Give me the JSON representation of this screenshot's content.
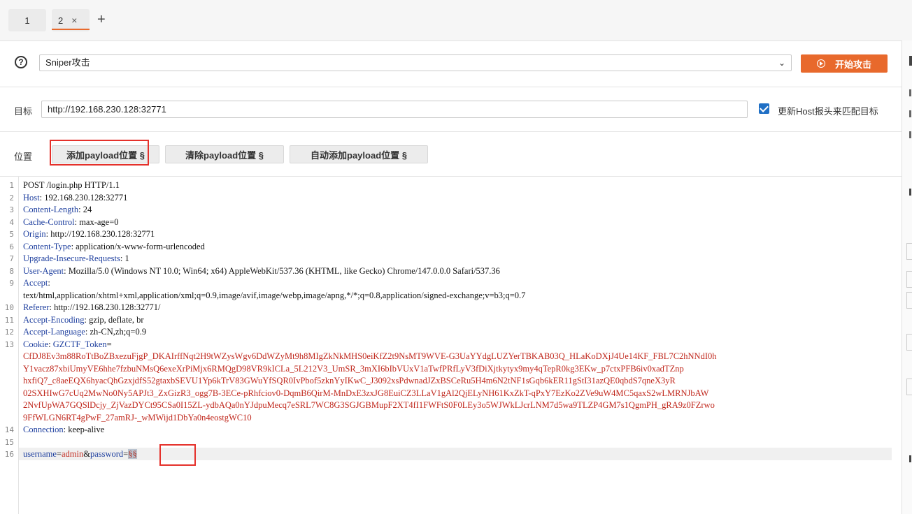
{
  "tabs": [
    {
      "label": "1"
    },
    {
      "label": "2",
      "close": "×"
    }
  ],
  "tab_add": "+",
  "attack": {
    "help": "?",
    "type_selected": "Sniper攻击",
    "start_button": "开始攻击"
  },
  "target": {
    "label": "目标",
    "url": "http://192.168.230.128:32771",
    "update_host_label": "更新Host报头来匹配目标",
    "update_host_checked": true
  },
  "positions": {
    "label": "位置",
    "add_button": "添加payload位置 §",
    "clear_button": "清除payload位置 §",
    "auto_button": "自动添加payload位置 §"
  },
  "request": {
    "line1": "POST /login.php HTTP/1.1",
    "headers": [
      {
        "name": "Host",
        "value": " 192.168.230.128:32771"
      },
      {
        "name": "Content-Length",
        "value": " 24"
      },
      {
        "name": "Cache-Control",
        "value": " max-age=0"
      },
      {
        "name": "Origin",
        "value": " http://192.168.230.128:32771"
      },
      {
        "name": "Content-Type",
        "value": " application/x-www-form-urlencoded"
      },
      {
        "name": "Upgrade-Insecure-Requests",
        "value": " 1"
      },
      {
        "name": "User-Agent",
        "value": " Mozilla/5.0 (Windows NT 10.0; Win64; x64) AppleWebKit/537.36 (KHTML, like Gecko) Chrome/147.0.0.0 Safari/537.36"
      },
      {
        "name": "Accept",
        "value": ""
      },
      {
        "name": "Referer",
        "value": " http://192.168.230.128:32771/"
      },
      {
        "name": "Accept-Encoding",
        "value": " gzip, deflate, br"
      },
      {
        "name": "Accept-Language",
        "value": " zh-CN,zh;q=0.9"
      }
    ],
    "accept_value": "text/html,application/xhtml+xml,application/xml;q=0.9,image/avif,image/webp,image/apng,*/*;q=0.8,application/signed-exchange;v=b3;q=0.7",
    "cookie_name": "Cookie",
    "cookie_key": "GZCTF_Token",
    "cookie_value_lines": [
      "CfDJ8Ev3m88RoTtBoZBxezuFjgP_DKAIrffNqt2H9tWZysWgv6DdWZyMt9h8MIgZkNkMHS0eiKfZ2t9NsMT9WVE-G3UaYYdgLUZYerTBKAB03Q_HLaKoDXjJ4Ue14KF_FBL7C2hNNdI0h",
      "Y1vacz87xbiUmyVE6hhe7fzbuNMsQ6exeXrPiMjx6RMQgD98VR9kICLa_5L212V3_UmSR_3mXI6bIbVUxV1aTwfPRfLyV3fDiXjtkytyx9my4qTepR0kg3EKw_p7ctxPFB6iv0xadTZnp",
      "hxfiQ7_c8aeEQX6hyacQhGzxjdfS52gtaxbSEVU1Yp6kTrV83GWuYfSQR0IvPbof5zknYyIKwC_J3092xsPdwnadJZxBSCeRu5H4m6N2tNF1sGqb6kER11gStI31azQE0qbdS7qneX3yR",
      "02SXHIwG7cUq2MwNo0Ny5APJt3_ZxGizR3_ogg7B-3ECe-pRhfciov0-DqmB6QirM-MnDxE3zxJG8EuiCZ3LLaV1gAl2QjELyNH61KxZkT-qPxY7EzKo2ZVe9uW4MC5qaxS2wLMRNJbAW",
      "2NvfUpWA7GQSlDcjy_ZjVazDYCt95CSa0I15ZL-ydbAQa0nYJdpuMecq7eSRL7WC8G3SGJGBMupF2XT4fI1FWFtS0F0LEy3o5WJWkLJcrLNM7d5wa9TLZP4GM7s1QgmPH_gRA9z0FZrwo",
      "9FfWLGN6RT4gPwF_27amRJ-_wMWijd1DbYa0n4eostgWC10"
    ],
    "connection": {
      "name": "Connection",
      "value": " keep-alive"
    },
    "body": {
      "p1_name": "username",
      "eq1": "=",
      "p1_value": "admin",
      "amp": "&",
      "p2_name": "password",
      "eq2": "=",
      "marker": "§§"
    },
    "line_numbers": [
      "1",
      "2",
      "3",
      "4",
      "5",
      "6",
      "7",
      "8",
      "9",
      "10",
      "11",
      "12",
      "13",
      "14",
      "15",
      "16"
    ]
  },
  "colors": {
    "accent": "#e8692c",
    "header_name": "#1d3e9e",
    "cookie_value": "#c0281d",
    "highlight_box": "#e5312b",
    "checkbox": "#1f6fc5"
  }
}
